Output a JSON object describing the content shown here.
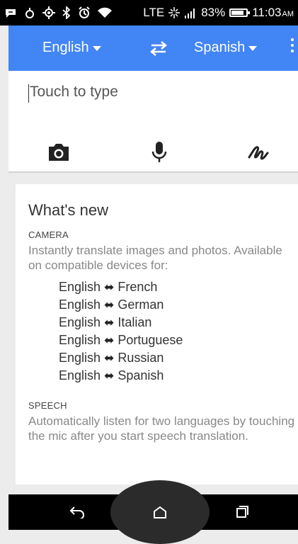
{
  "status_bar": {
    "network": "LTE",
    "battery": "83%",
    "battery_level": 0.83,
    "time": "11:03",
    "ampm": "AM"
  },
  "app_bar": {
    "source_language": "English",
    "target_language": "Spanish",
    "accent": "#4285f4"
  },
  "input": {
    "placeholder": "Touch to type",
    "tools": [
      "camera-icon",
      "microphone-icon",
      "handwriting-icon"
    ]
  },
  "whats_new": {
    "title": "What's new",
    "camera": {
      "label": "CAMERA",
      "description": "Instantly translate images and photos. Available on compatible devices for:",
      "pairs": [
        {
          "from": "English",
          "to": "French"
        },
        {
          "from": "English",
          "to": "German"
        },
        {
          "from": "English",
          "to": "Italian"
        },
        {
          "from": "English",
          "to": "Portuguese"
        },
        {
          "from": "English",
          "to": "Russian"
        },
        {
          "from": "English",
          "to": "Spanish"
        }
      ],
      "arrow": "⬌"
    },
    "speech": {
      "label": "SPEECH",
      "description": "Automatically listen for two languages by touching the mic after you start speech translation."
    }
  },
  "nav_bar": {
    "icons": [
      "back-icon",
      "home-icon",
      "recent-apps-icon"
    ]
  }
}
